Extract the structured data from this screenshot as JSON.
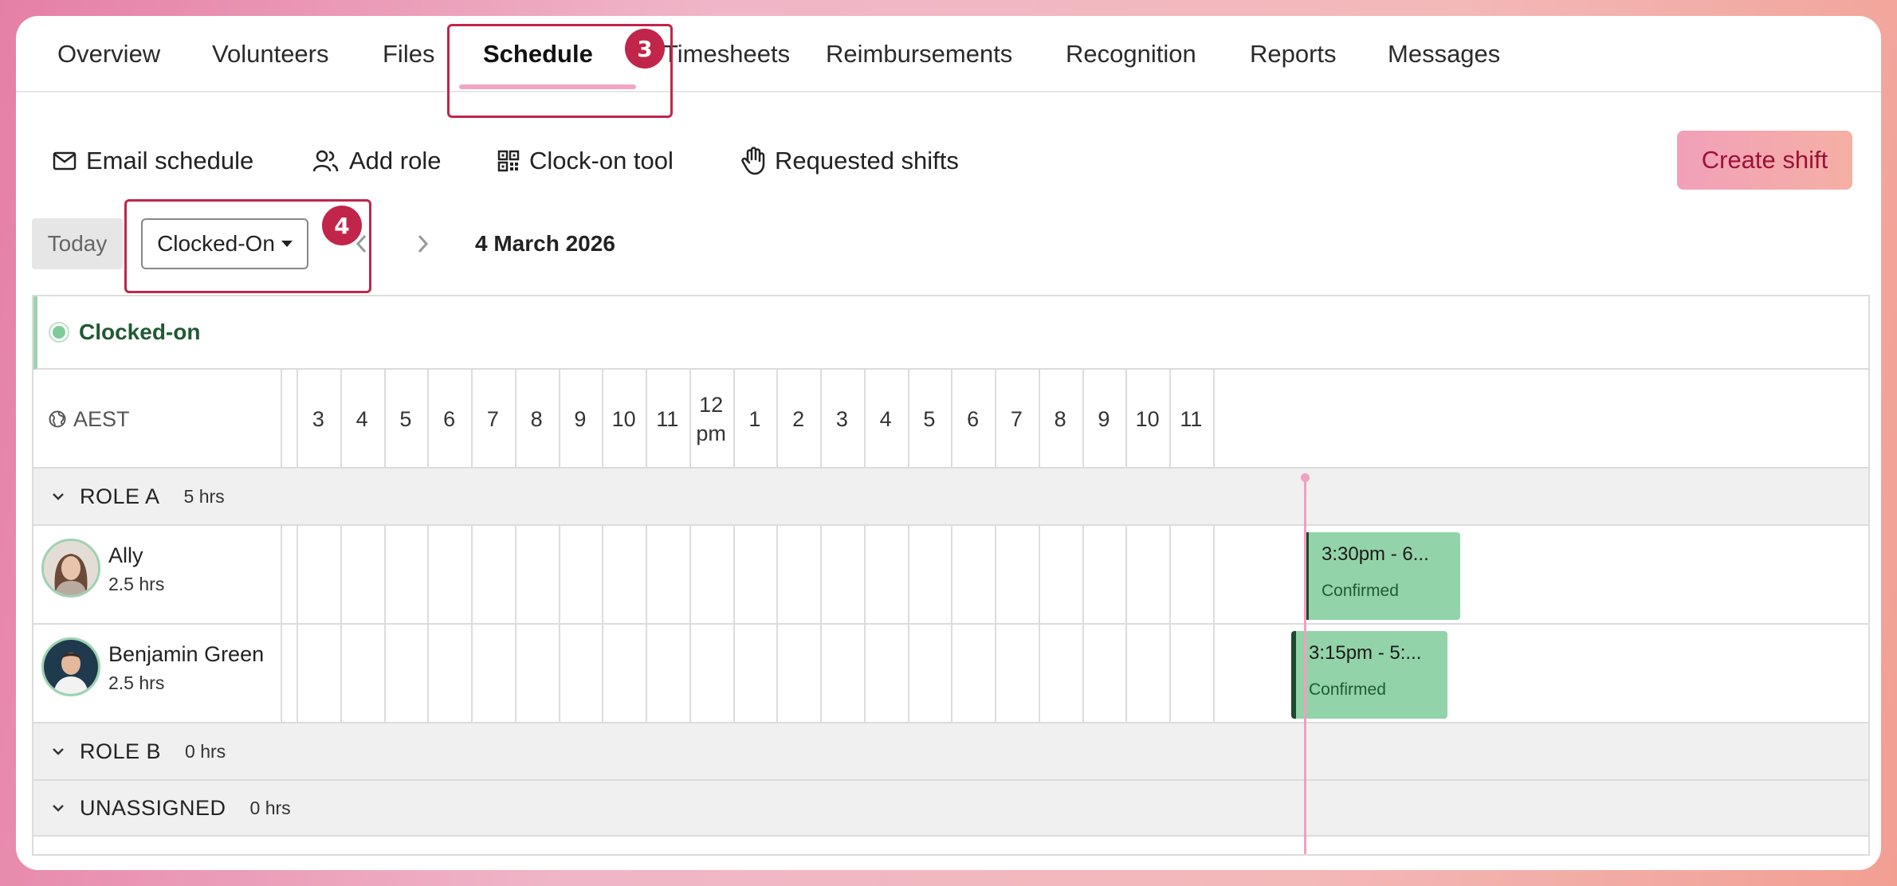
{
  "tabs": [
    {
      "label": "Overview"
    },
    {
      "label": "Volunteers"
    },
    {
      "label": "Files"
    },
    {
      "label": "Schedule",
      "active": true
    },
    {
      "label": "Timesheets"
    },
    {
      "label": "Reimbursements"
    },
    {
      "label": "Recognition"
    },
    {
      "label": "Reports"
    },
    {
      "label": "Messages"
    }
  ],
  "callouts": {
    "step3": "3",
    "step4": "4"
  },
  "toolbar": {
    "email_schedule": "Email schedule",
    "add_role": "Add role",
    "clock_on_tool": "Clock-on tool",
    "requested_shifts": "Requested shifts",
    "create_shift": "Create shift"
  },
  "date_nav": {
    "today": "Today",
    "view": "Clocked-On",
    "date": "4 March 2026"
  },
  "filter": {
    "label": "Clocked-on"
  },
  "timezone": "AEST",
  "hours": [
    "3",
    "4",
    "5",
    "6",
    "7",
    "8",
    "9",
    "10",
    "11",
    "12\npm",
    "1",
    "2",
    "3",
    "4",
    "5",
    "6",
    "7",
    "8",
    "9",
    "10",
    "11"
  ],
  "groups": {
    "role_a": {
      "name": "ROLE A",
      "hours": "5 hrs"
    },
    "role_b": {
      "name": "ROLE B",
      "hours": "0 hrs"
    },
    "unassigned": {
      "name": "UNASSIGNED",
      "hours": "0 hrs"
    }
  },
  "people": [
    {
      "name": "Ally",
      "hours": "2.5 hrs",
      "shift": {
        "time": "3:30pm - 6...",
        "status": "Confirmed"
      }
    },
    {
      "name": "Benjamin Green",
      "hours": "2.5 hrs",
      "shift": {
        "time": "3:15pm - 5:...",
        "status": "Confirmed"
      }
    }
  ],
  "colors": {
    "accent_pink": "#f2a6c4",
    "callout_red": "#c1254a",
    "shift_green": "#93d3a9",
    "clocked_on_green": "#1f5a34"
  }
}
